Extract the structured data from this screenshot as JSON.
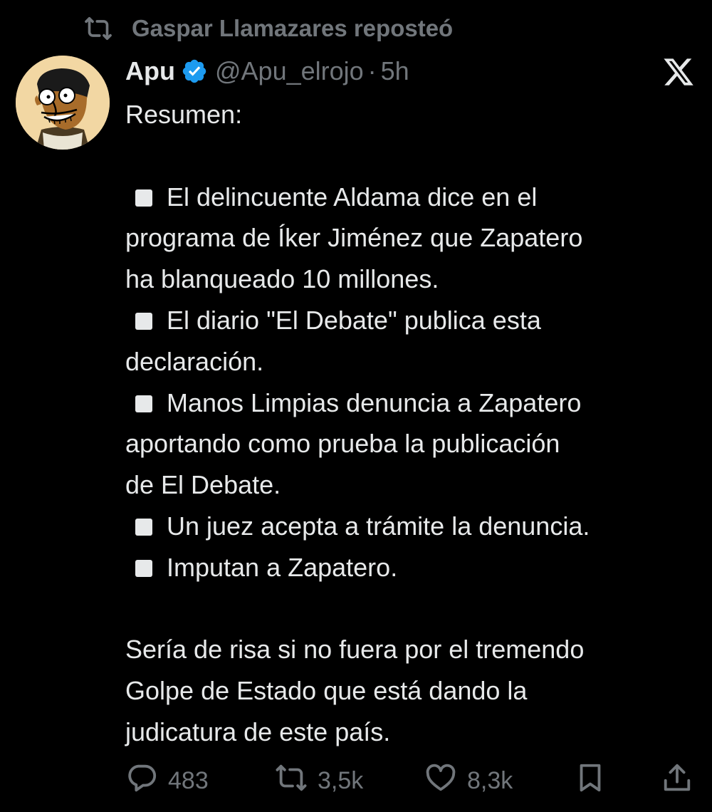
{
  "repost": {
    "text": "Gaspar Llamazares reposteó",
    "icon": "repost-icon"
  },
  "author": {
    "name": "Apu",
    "handle": "@Apu_elrojo",
    "separator": "·",
    "time": "5h",
    "verified_icon": "verified-badge-icon",
    "verified_color": "#1d9bf0"
  },
  "brand_icon": "x-logo-icon",
  "tweet": {
    "lines": [
      {
        "text": "Resumen:",
        "bullet": false
      },
      {
        "text": "",
        "bullet": false
      },
      {
        "text": "El delincuente Aldama dice en el",
        "bullet": true
      },
      {
        "text": "programa de Íker Jiménez que Zapatero",
        "bullet": false
      },
      {
        "text": "ha blanqueado 10 millones.",
        "bullet": false
      },
      {
        "text": "El diario \"El Debate\" publica esta",
        "bullet": true
      },
      {
        "text": "declaración.",
        "bullet": false
      },
      {
        "text": "Manos Limpias denuncia a Zapatero",
        "bullet": true
      },
      {
        "text": "aportando como prueba la publicación",
        "bullet": false
      },
      {
        "text": "de El Debate.",
        "bullet": false
      },
      {
        "text": "Un juez acepta a trámite la denuncia.",
        "bullet": true
      },
      {
        "text": "Imputan a Zapatero.",
        "bullet": true
      },
      {
        "text": "",
        "bullet": false
      },
      {
        "text": "Sería de risa si no fuera por el tremendo",
        "bullet": false
      },
      {
        "text": "Golpe de Estado que está dando la",
        "bullet": false
      },
      {
        "text": "judicatura de este país.",
        "bullet": false
      }
    ]
  },
  "actions": {
    "replies": {
      "count": "483",
      "icon": "reply-icon"
    },
    "reposts": {
      "count": "3,5k",
      "icon": "repost-icon"
    },
    "likes": {
      "count": "8,3k",
      "icon": "heart-icon"
    },
    "bookmark": {
      "icon": "bookmark-icon"
    },
    "share": {
      "icon": "share-icon"
    }
  },
  "colors": {
    "background": "#000000",
    "text": "#e7e9ea",
    "muted": "#71767b",
    "accent": "#1d9bf0"
  }
}
